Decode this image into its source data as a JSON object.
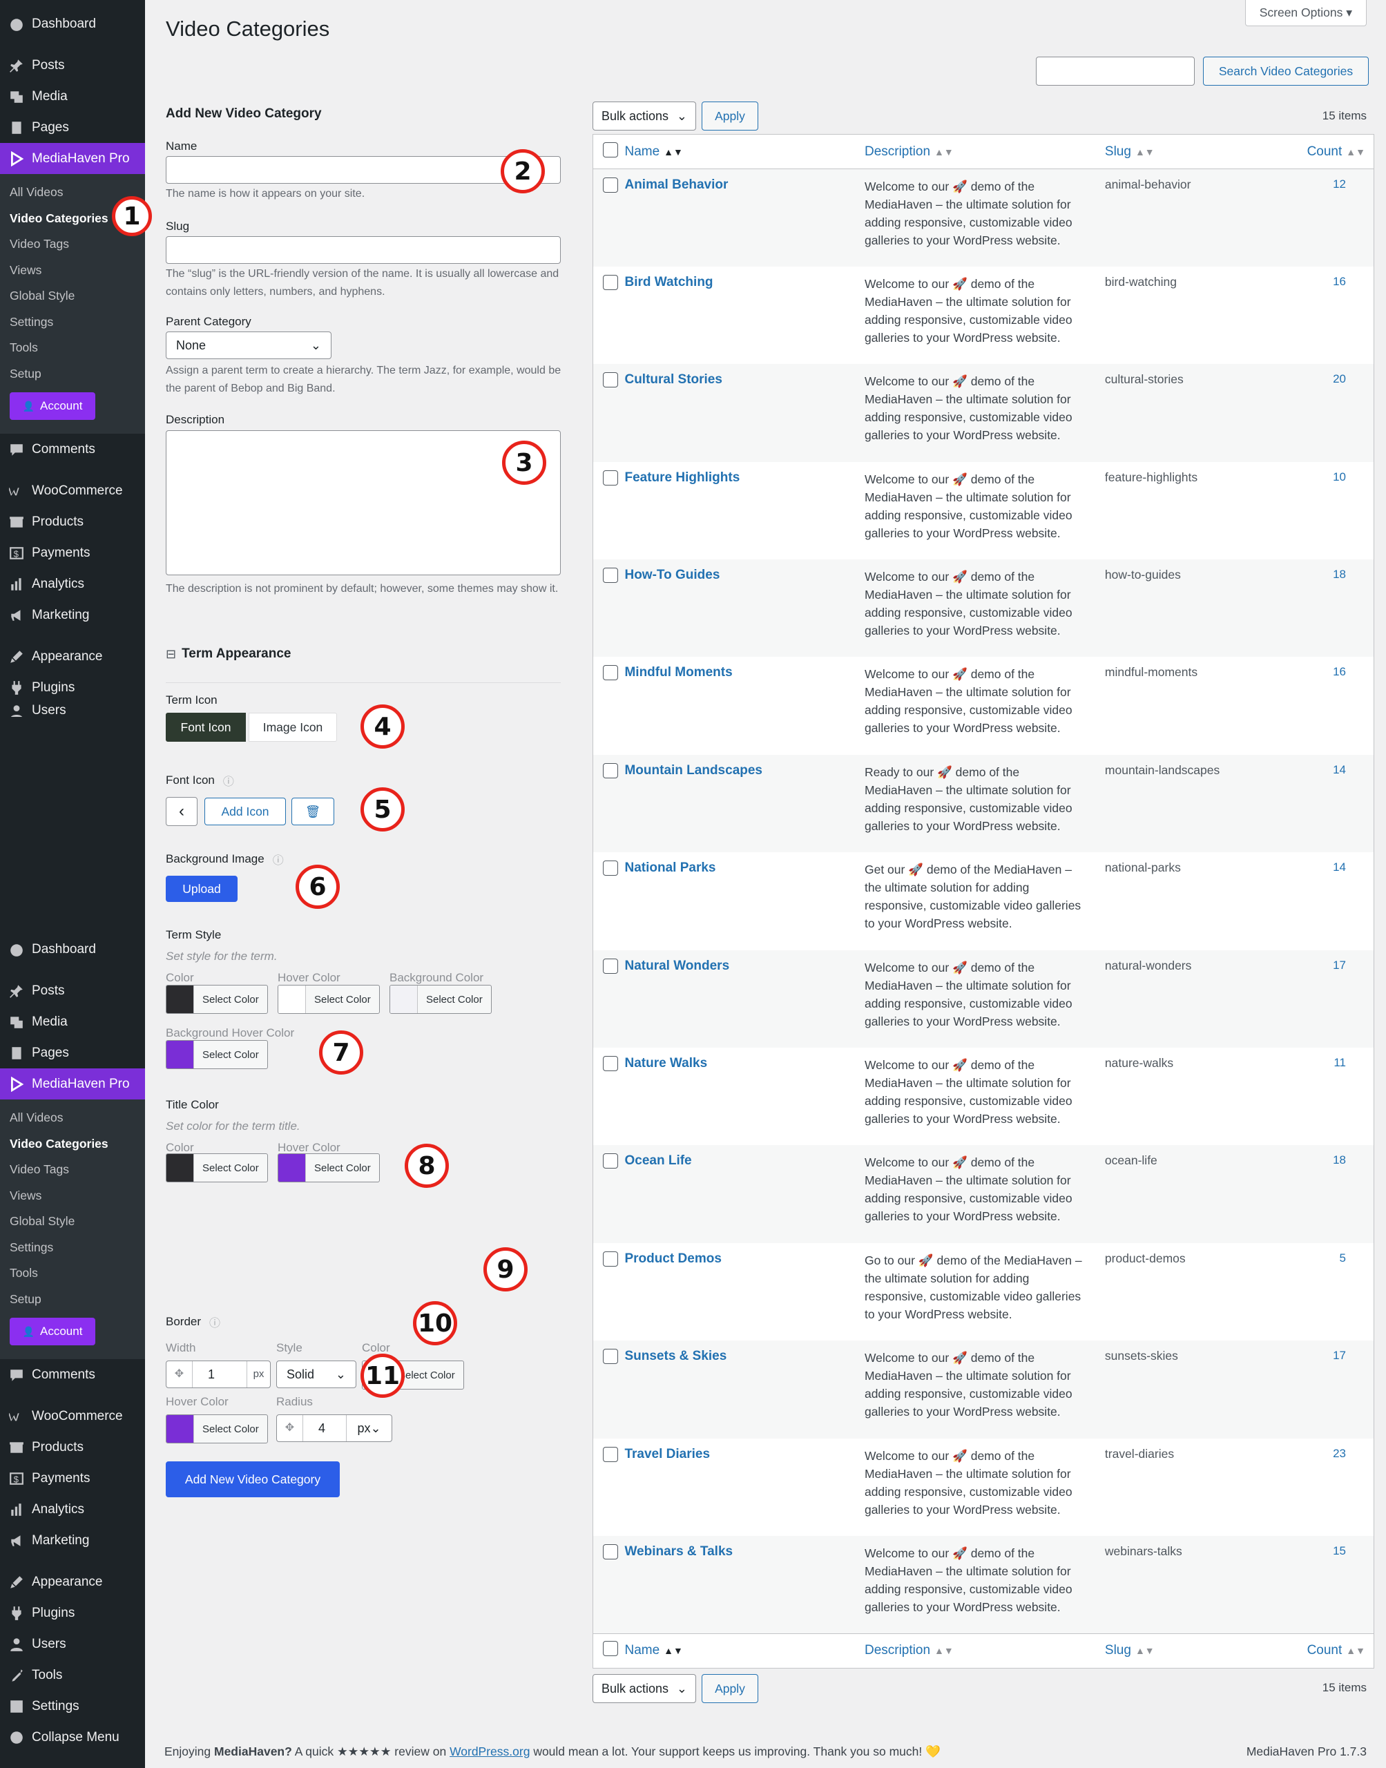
{
  "sidebar": {
    "menu1": [
      {
        "label": "Dashboard",
        "icon": "dashboard-icon"
      },
      {
        "label": "Posts",
        "icon": "pin-icon"
      },
      {
        "label": "Media",
        "icon": "media-icon"
      },
      {
        "label": "Pages",
        "icon": "pages-icon"
      },
      {
        "label": "MediaHaven Pro",
        "icon": "mediahaven-icon"
      }
    ],
    "sub": [
      "All Videos",
      "Video Categories",
      "Video Tags",
      "Views",
      "Global Style",
      "Settings",
      "Tools",
      "Setup"
    ],
    "account": "Account",
    "menu2": [
      {
        "label": "Comments"
      },
      {
        "label": "WooCommerce"
      },
      {
        "label": "Products"
      },
      {
        "label": "Payments"
      },
      {
        "label": "Analytics"
      },
      {
        "label": "Marketing"
      },
      {
        "label": "Appearance"
      },
      {
        "label": "Plugins"
      },
      {
        "label": "Users"
      },
      {
        "label": "Tools"
      },
      {
        "label": "Settings"
      },
      {
        "label": "Collapse Menu"
      }
    ]
  },
  "page": {
    "title": "Video Categories",
    "screen_options": "Screen Options ▾",
    "search_button": "Search Video Categories",
    "items_count": "15 items",
    "bulk_actions": "Bulk actions",
    "apply": "Apply"
  },
  "form": {
    "heading": "Add New Video Category",
    "name_label": "Name",
    "name_help": "The name is how it appears on your site.",
    "slug_label": "Slug",
    "slug_help": "The “slug” is the URL-friendly version of the name. It is usually all lowercase and contains only letters, numbers, and hyphens.",
    "parent_label": "Parent Category",
    "parent_value": "None",
    "parent_help": "Assign a parent term to create a hierarchy. The term Jazz, for example, would be the parent of Bebop and Big Band.",
    "description_label": "Description",
    "description_help": "The description is not prominent by default; however, some themes may show it.",
    "appearance_heading": "Term Appearance",
    "term_icon_label": "Term Icon",
    "font_icon_tab": "Font Icon",
    "image_icon_tab": "Image Icon",
    "font_icon_label": "Font Icon",
    "add_icon": "Add Icon",
    "bg_image_label": "Background Image",
    "upload": "Upload",
    "term_style_label": "Term Style",
    "term_style_help": "Set style for the term.",
    "color_label": "Color",
    "hover_color_label": "Hover Color",
    "bg_color_label": "Background Color",
    "bg_hover_label": "Background Hover Color",
    "select_color": "Select Color",
    "title_color_label": "Title Color",
    "title_color_help": "Set color for the term title.",
    "border_label": "Border",
    "width_label": "Width",
    "style_label": "Style",
    "border_color_label": "Color",
    "width_value": "1",
    "width_unit": "px",
    "style_value": "Solid",
    "radius_label": "Radius",
    "radius_value": "4",
    "radius_unit": "px",
    "submit": "Add New Video Category"
  },
  "colors": {
    "swatch_dark": "#2b2b2e",
    "swatch_white": "#ffffff",
    "swatch_light": "#f2f2f6",
    "swatch_purple": "#7a2ed6",
    "accent": "#2271b1",
    "primary": "#2c5ee8"
  },
  "table": {
    "headers": {
      "name": "Name",
      "description": "Description",
      "slug": "Slug",
      "count": "Count"
    },
    "rows": [
      {
        "name": "Animal Behavior",
        "description": "Welcome to our 🚀 demo of the MediaHaven – the ultimate solution for adding responsive, customizable video galleries to your WordPress website.",
        "slug": "animal-behavior",
        "count": "12"
      },
      {
        "name": "Bird Watching",
        "description": "Welcome to our 🚀 demo of the MediaHaven – the ultimate solution for adding responsive, customizable video galleries to your WordPress website.",
        "slug": "bird-watching",
        "count": "16"
      },
      {
        "name": "Cultural Stories",
        "description": "Welcome to our 🚀 demo of the MediaHaven – the ultimate solution for adding responsive, customizable video galleries to your WordPress website.",
        "slug": "cultural-stories",
        "count": "20"
      },
      {
        "name": "Feature Highlights",
        "description": "Welcome to our 🚀 demo of the MediaHaven – the ultimate solution for adding responsive, customizable video galleries to your WordPress website.",
        "slug": "feature-highlights",
        "count": "10"
      },
      {
        "name": "How-To Guides",
        "description": "Welcome to our 🚀 demo of the MediaHaven – the ultimate solution for adding responsive, customizable video galleries to your WordPress website.",
        "slug": "how-to-guides",
        "count": "18"
      },
      {
        "name": "Mindful Moments",
        "description": "Welcome to our 🚀 demo of the MediaHaven – the ultimate solution for adding responsive, customizable video galleries to your WordPress website.",
        "slug": "mindful-moments",
        "count": "16"
      },
      {
        "name": "Mountain Landscapes",
        "description": "Ready to our 🚀 demo of the MediaHaven – the ultimate solution for adding responsive, customizable video galleries to your WordPress website.",
        "slug": "mountain-landscapes",
        "count": "14"
      },
      {
        "name": "National Parks",
        "description": "Get our 🚀 demo of the MediaHaven – the ultimate solution for adding responsive, customizable video galleries to your WordPress website.",
        "slug": "national-parks",
        "count": "14"
      },
      {
        "name": "Natural Wonders",
        "description": "Welcome to our 🚀 demo of the MediaHaven – the ultimate solution for adding responsive, customizable video galleries to your WordPress website.",
        "slug": "natural-wonders",
        "count": "17"
      },
      {
        "name": "Nature Walks",
        "description": "Welcome to our 🚀 demo of the MediaHaven – the ultimate solution for adding responsive, customizable video galleries to your WordPress website.",
        "slug": "nature-walks",
        "count": "11"
      },
      {
        "name": "Ocean Life",
        "description": "Welcome to our 🚀 demo of the MediaHaven – the ultimate solution for adding responsive, customizable video galleries to your WordPress website.",
        "slug": "ocean-life",
        "count": "18"
      },
      {
        "name": "Product Demos",
        "description": "Go to our 🚀 demo of the MediaHaven – the ultimate solution for adding responsive, customizable video galleries to your WordPress website.",
        "slug": "product-demos",
        "count": "5"
      },
      {
        "name": "Sunsets & Skies",
        "description": "Welcome to our 🚀 demo of the MediaHaven – the ultimate solution for adding responsive, customizable video galleries to your WordPress website.",
        "slug": "sunsets-skies",
        "count": "17"
      },
      {
        "name": "Travel Diaries",
        "description": "Welcome to our 🚀 demo of the MediaHaven – the ultimate solution for adding responsive, customizable video galleries to your WordPress website.",
        "slug": "travel-diaries",
        "count": "23"
      },
      {
        "name": "Webinars & Talks",
        "description": "Welcome to our 🚀 demo of the MediaHaven – the ultimate solution for adding responsive, customizable video galleries to your WordPress website.",
        "slug": "webinars-talks",
        "count": "15"
      }
    ]
  },
  "callouts": [
    "1",
    "2",
    "3",
    "4",
    "5",
    "6",
    "7",
    "8",
    "9",
    "10",
    "11"
  ],
  "footer": {
    "pre": "Enjoying ",
    "brand": "MediaHaven?",
    "mid": " A quick ★★★★★ review on ",
    "link": "WordPress.org",
    "post": " would mean a lot. Your support keeps us improving. Thank you so much! 💛",
    "version": "MediaHaven Pro 1.7.3"
  }
}
